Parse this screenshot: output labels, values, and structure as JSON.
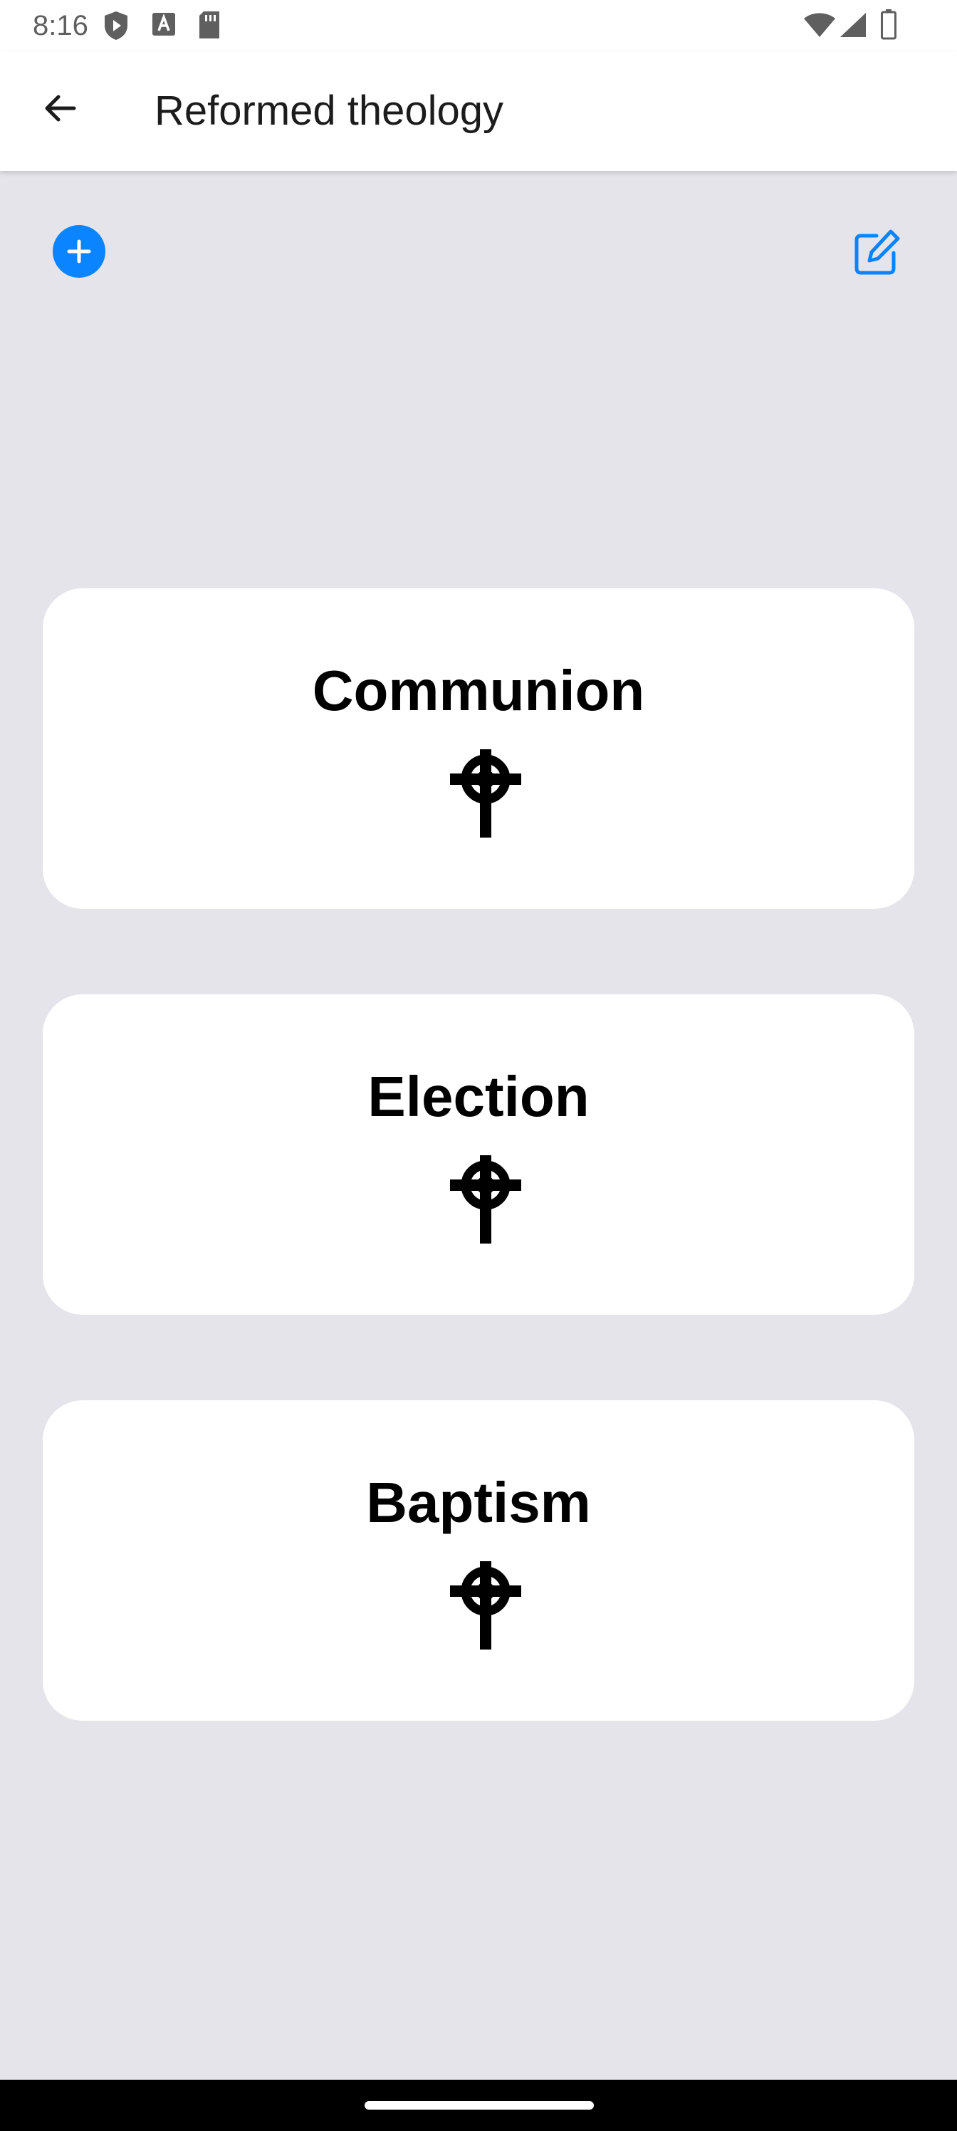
{
  "status_bar": {
    "time": "8:16",
    "left_icons": [
      "shield-play-icon",
      "font-icon",
      "sd-card-icon"
    ],
    "right_icons": [
      "wifi-icon",
      "cellular-signal-icon",
      "battery-icon"
    ]
  },
  "app_bar": {
    "title": "Reformed theology",
    "back_icon": "arrow-left-icon"
  },
  "toolbar": {
    "add_icon": "plus-circle-icon",
    "edit_icon": "edit-square-icon",
    "accent_color": "#0a84ff"
  },
  "cards": [
    {
      "title": "Communion",
      "icon": "celtic-cross-icon"
    },
    {
      "title": "Election",
      "icon": "celtic-cross-icon"
    },
    {
      "title": "Baptism",
      "icon": "celtic-cross-icon"
    }
  ],
  "colors": {
    "background": "#e5e4ea",
    "card": "#ffffff",
    "text": "#000000"
  }
}
